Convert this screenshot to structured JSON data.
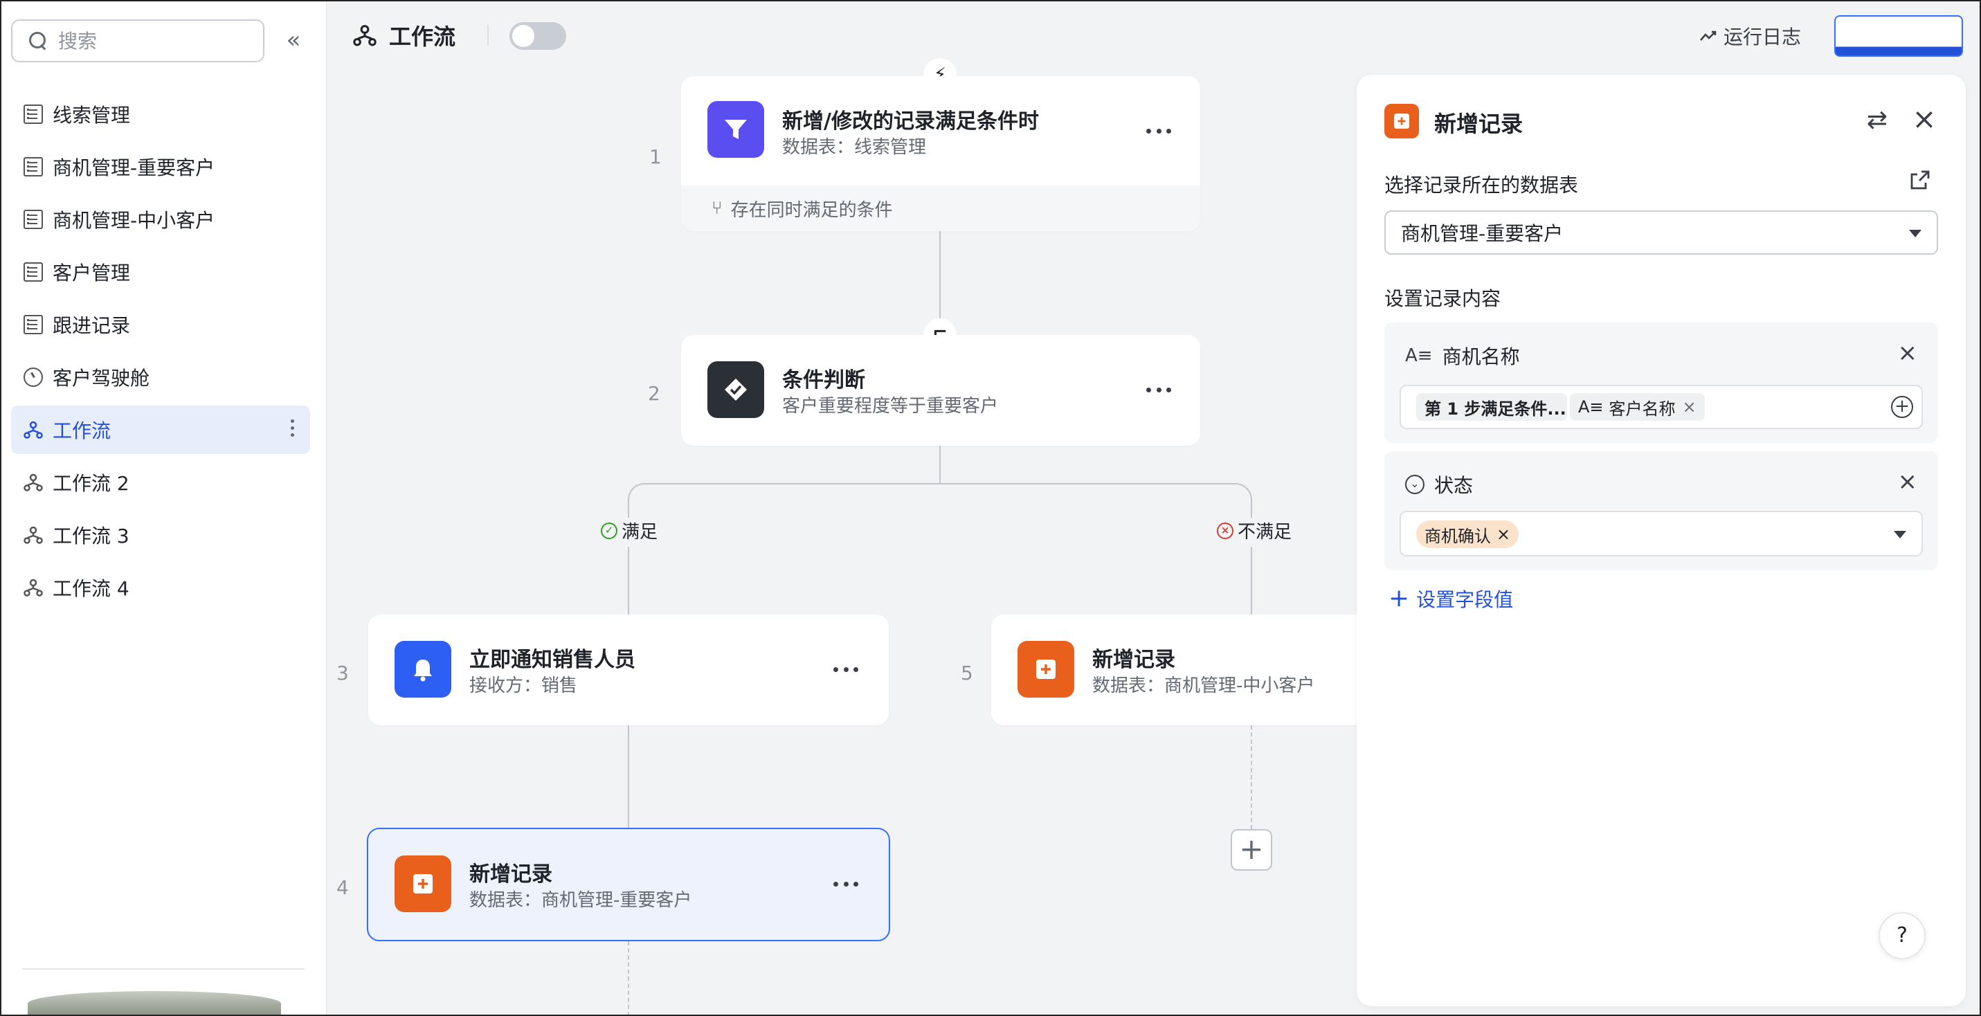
{
  "sidebar": {
    "search_placeholder": "搜索",
    "collapse_icon": "double-chevron-left-icon",
    "items": [
      {
        "label": "线索管理",
        "icon": "table-icon"
      },
      {
        "label": "商机管理-重要客户",
        "icon": "table-icon"
      },
      {
        "label": "商机管理-中小客户",
        "icon": "table-icon"
      },
      {
        "label": "客户管理",
        "icon": "table-icon"
      },
      {
        "label": "跟进记录",
        "icon": "table-icon"
      },
      {
        "label": "客户驾驶舱",
        "icon": "dashboard-icon"
      },
      {
        "label": "工作流",
        "icon": "workflow-icon",
        "active": true
      },
      {
        "label": "工作流 2",
        "icon": "workflow-icon"
      },
      {
        "label": "工作流 3",
        "icon": "workflow-icon"
      },
      {
        "label": "工作流 4",
        "icon": "workflow-icon"
      }
    ]
  },
  "topbar": {
    "title": "工作流",
    "toggle_on": false,
    "run_log": "运行日志"
  },
  "flow": {
    "steps": [
      {
        "no": "1",
        "title": "新增/修改的记录满足条件时",
        "sub": "数据表：线索管理",
        "foot": "存在同时满足的条件",
        "icon_color": "#5b4ef0"
      },
      {
        "no": "2",
        "title": "条件判断",
        "sub": "客户重要程度等于重要客户",
        "icon_color": "#2b2f36"
      },
      {
        "no": "3",
        "title": "立即通知销售人员",
        "sub": "接收方：销售",
        "icon_color": "#2d5ff5"
      },
      {
        "no": "4",
        "title": "新增记录",
        "sub": "数据表：商机管理-重要客户",
        "icon_color": "#e8601c",
        "selected": true
      },
      {
        "no": "5",
        "title": "新增记录",
        "sub": "数据表：商机管理-中小客户",
        "icon_color": "#e8601c"
      }
    ],
    "branch_yes": "满足",
    "branch_no": "不满足",
    "colors": {
      "yes": "#2ea121",
      "no": "#d83931"
    }
  },
  "panel": {
    "title": "新增记录",
    "table_label": "选择记录所在的数据表",
    "table_value": "商机管理-重要客户",
    "content_label": "设置记录内容",
    "fields": [
      {
        "name": "商机名称",
        "chips": [
          "第 1 步满足条件...",
          "客户名称"
        ]
      },
      {
        "name": "状态",
        "value": "商机确认"
      }
    ],
    "add_field": "设置字段值",
    "help": "?"
  }
}
